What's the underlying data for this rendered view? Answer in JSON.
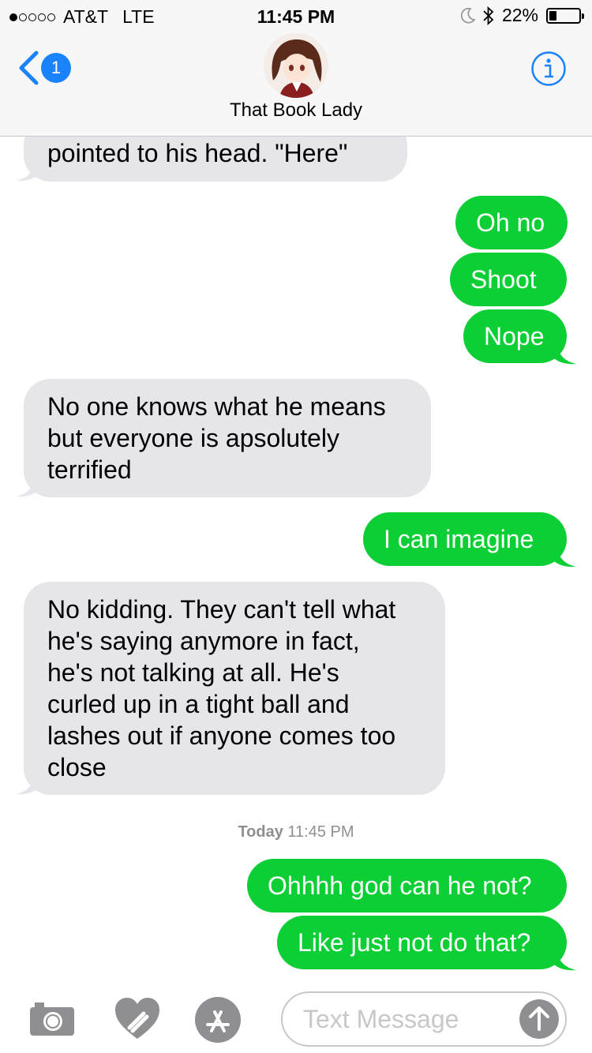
{
  "status": {
    "carrier": "AT&T",
    "network": "LTE",
    "time": "11:45 PM",
    "battery": "22%",
    "battery_level": 0.22,
    "signal_bars_filled": 1
  },
  "nav": {
    "back_count": "1",
    "contact_name": "That Book Lady"
  },
  "messages": [
    {
      "dir": "in",
      "text": "pointed to his head. \"Here\""
    },
    {
      "dir": "out",
      "text": "Oh no"
    },
    {
      "dir": "out",
      "text": "Shoot"
    },
    {
      "dir": "out",
      "text": "Nope"
    },
    {
      "dir": "in",
      "lines": [
        "No one knows what he means",
        "but everyone is apsolutely",
        "terrified"
      ]
    },
    {
      "dir": "out",
      "text": "I can imagine"
    },
    {
      "dir": "in",
      "lines": [
        "No kidding. They can't tell what",
        "he's saying anymore in fact,",
        "he's not talking at all. He's",
        "curled up in a tight ball and",
        "lashes out if anyone comes too",
        "close"
      ]
    },
    {
      "dir": "out",
      "text": "Ohhhh god can he not?"
    },
    {
      "dir": "out",
      "text": "Like just not do that?"
    }
  ],
  "timestamp": {
    "day": "Today",
    "time": "11:45 PM"
  },
  "compose": {
    "placeholder": "Text Message"
  },
  "icons": [
    "chevron-left-icon",
    "info-icon",
    "camera-icon",
    "digital-touch-heart-icon",
    "app-store-icon",
    "send-arrow-icon",
    "moon-icon",
    "bluetooth-icon"
  ],
  "colors": {
    "outgoing": "#0ccf35",
    "incoming": "#e5e5ea",
    "accent": "#1a82fb"
  }
}
